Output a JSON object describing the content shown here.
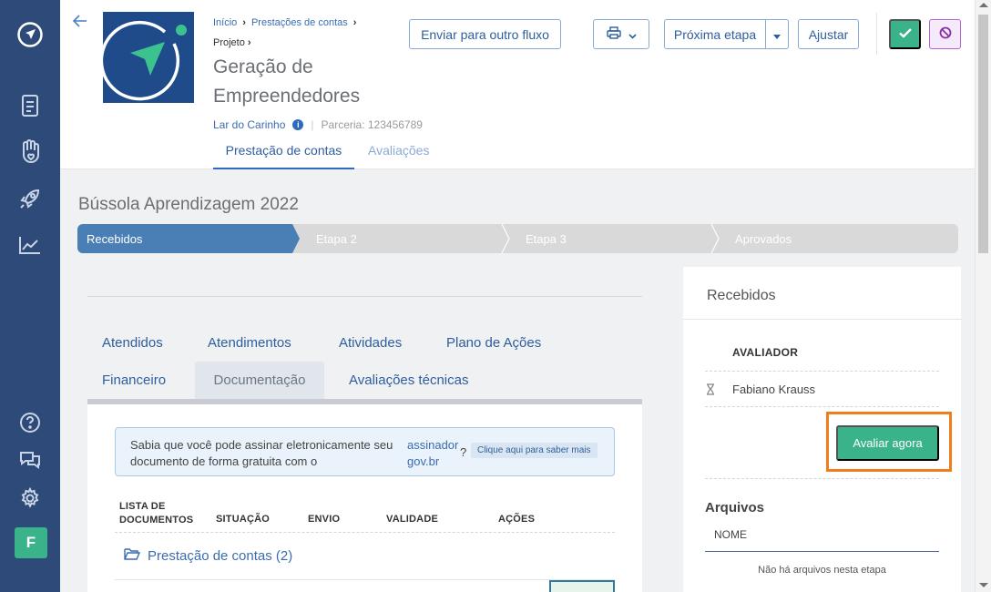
{
  "sidebar": {
    "nav": [
      {
        "icon": "document-icon"
      },
      {
        "icon": "hand-heart-icon"
      },
      {
        "icon": "rocket-icon"
      },
      {
        "icon": "chart-line-icon"
      }
    ],
    "bottom": [
      {
        "icon": "help-icon"
      },
      {
        "icon": "chat-icon"
      },
      {
        "icon": "settings-icon"
      }
    ],
    "avatar_letter": "F"
  },
  "header": {
    "breadcrumb": [
      "Início",
      "Prestações de contas"
    ],
    "breadcrumb_sub": "Projeto",
    "title": "Geração de Empreendedores",
    "organization": "Lar do Carinho",
    "partnership": "Parceria: 123456789",
    "tabs": [
      {
        "label": "Prestação de contas",
        "active": true
      },
      {
        "label": "Avaliações",
        "active": false
      }
    ],
    "actions": {
      "send_flow": "Enviar para outro fluxo",
      "next_stage": "Próxima etapa",
      "adjust": "Ajustar"
    }
  },
  "main": {
    "section_title": "Bússola Aprendizagem 2022",
    "steps": [
      {
        "label": "Recebidos",
        "active": true
      },
      {
        "label": "Etapa 2",
        "active": false
      },
      {
        "label": "Etapa 3",
        "active": false
      },
      {
        "label": "Aprovados",
        "active": false
      }
    ],
    "tabs_row1": [
      "Atendidos",
      "Atendimentos",
      "Atividades",
      "Plano de Ações"
    ],
    "tabs_row2": [
      "Financeiro",
      "Documentação",
      "Avaliações técnicas"
    ],
    "active_tab": "Documentação",
    "notice": {
      "text": "Sabia que você pode assinar eletronicamente seu documento de forma gratuita com o",
      "link": "assinador gov.br",
      "question": "?",
      "pill": "Clique aqui para saber mais"
    },
    "table": {
      "headers": [
        "LISTA DE DOCUMENTOS",
        "SITUAÇÃO",
        "ENVIO",
        "VALIDADE",
        "AÇÕES"
      ],
      "folder": "Prestação de contas (2)"
    }
  },
  "right_panel": {
    "title": "Recebidos",
    "evaluator_header": "AVALIADOR",
    "evaluator": "Fabiano Krauss",
    "evaluate_button": "Avaliar agora",
    "files_title": "Arquivos",
    "files_header": "NOME",
    "files_empty": "Não há arquivos nesta etapa"
  },
  "colors": {
    "sidebar": "#2e4a78",
    "accent_blue": "#2e5e9e",
    "green": "#3bb38a",
    "step_active": "#4a7fb5",
    "highlight": "#f07d1e"
  }
}
